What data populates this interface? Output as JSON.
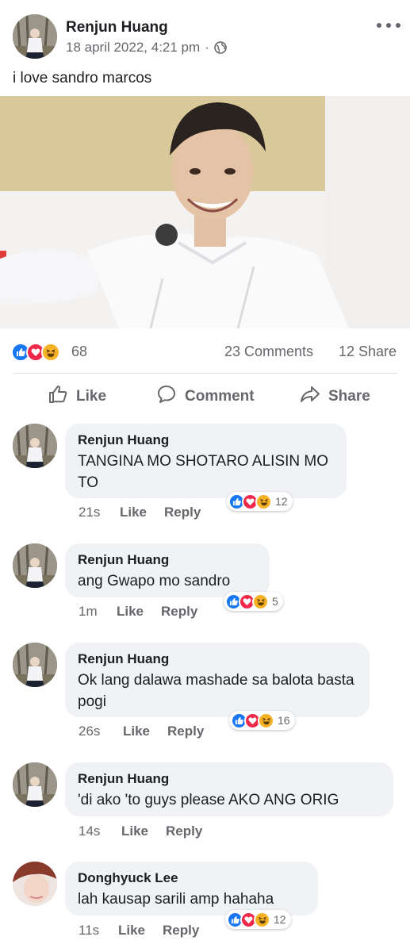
{
  "post": {
    "author": "Renjun Huang",
    "date": "18 april 2022, 4:21 pm",
    "separator": "·",
    "text": "i love sandro marcos"
  },
  "reactions": {
    "count": "68",
    "comments": "23 Comments",
    "shares": "12 Share"
  },
  "actions": {
    "like": "Like",
    "comment": "Comment",
    "share": "Share"
  },
  "comments": [
    {
      "name": "Renjun Huang",
      "text": "TANGINA MO SHOTARO ALISIN MO TO",
      "time": "21s",
      "like": "Like",
      "reply": "Reply",
      "reactions": "12"
    },
    {
      "name": "Renjun Huang",
      "text": "ang Gwapo mo sandro",
      "time": "1m",
      "like": "Like",
      "reply": "Reply",
      "reactions": "5"
    },
    {
      "name": "Renjun Huang",
      "text": "Ok lang dalawa mashade sa balota basta pogi",
      "time": "26s",
      "like": "Like",
      "reply": "Reply",
      "reactions": "16"
    },
    {
      "name": "Renjun Huang",
      "text": "'di ako 'to guys please AKO ANG ORIG",
      "time": "14s",
      "like": "Like",
      "reply": "Reply",
      "reactions": ""
    },
    {
      "name": "Donghyuck Lee",
      "text": "lah kausap sarili amp hahaha",
      "time": "11s",
      "like": "Like",
      "reply": "Reply",
      "reactions": "12"
    }
  ],
  "icons": {
    "more": "more-horizontal-icon",
    "privacy": "globe-icon",
    "like": "thumbs-up-icon",
    "comment": "speech-bubble-icon",
    "share": "share-arrow-icon"
  },
  "colors": {
    "like_blue": "#1877f2",
    "love_red": "#f0284a",
    "haha_yellow": "#f7b125",
    "meta_gray": "#65676b",
    "bubble_bg": "#f0f2f5"
  }
}
